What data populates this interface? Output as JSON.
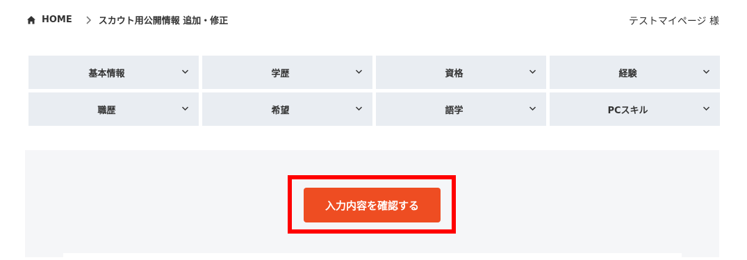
{
  "header": {
    "breadcrumb": {
      "home_label": "HOME",
      "current_label": "スカウト用公開情報 追加・修正"
    },
    "user_name": "テストマイページ 様"
  },
  "tabs": [
    {
      "label": "基本情報"
    },
    {
      "label": "学歴"
    },
    {
      "label": "資格"
    },
    {
      "label": "経験"
    },
    {
      "label": "職歴"
    },
    {
      "label": "希望"
    },
    {
      "label": "語学"
    },
    {
      "label": "PCスキル"
    }
  ],
  "form": {
    "confirm_button_label": "入力内容を確認する"
  },
  "colors": {
    "accent": "#ee4d22",
    "highlight": "#ff0000",
    "tab_bg": "#e9edf2",
    "form_bg": "#f5f6f8"
  },
  "icons": {
    "home": "home-icon",
    "separator": "chevron-right-icon",
    "tab_toggle": "chevron-down-icon"
  }
}
